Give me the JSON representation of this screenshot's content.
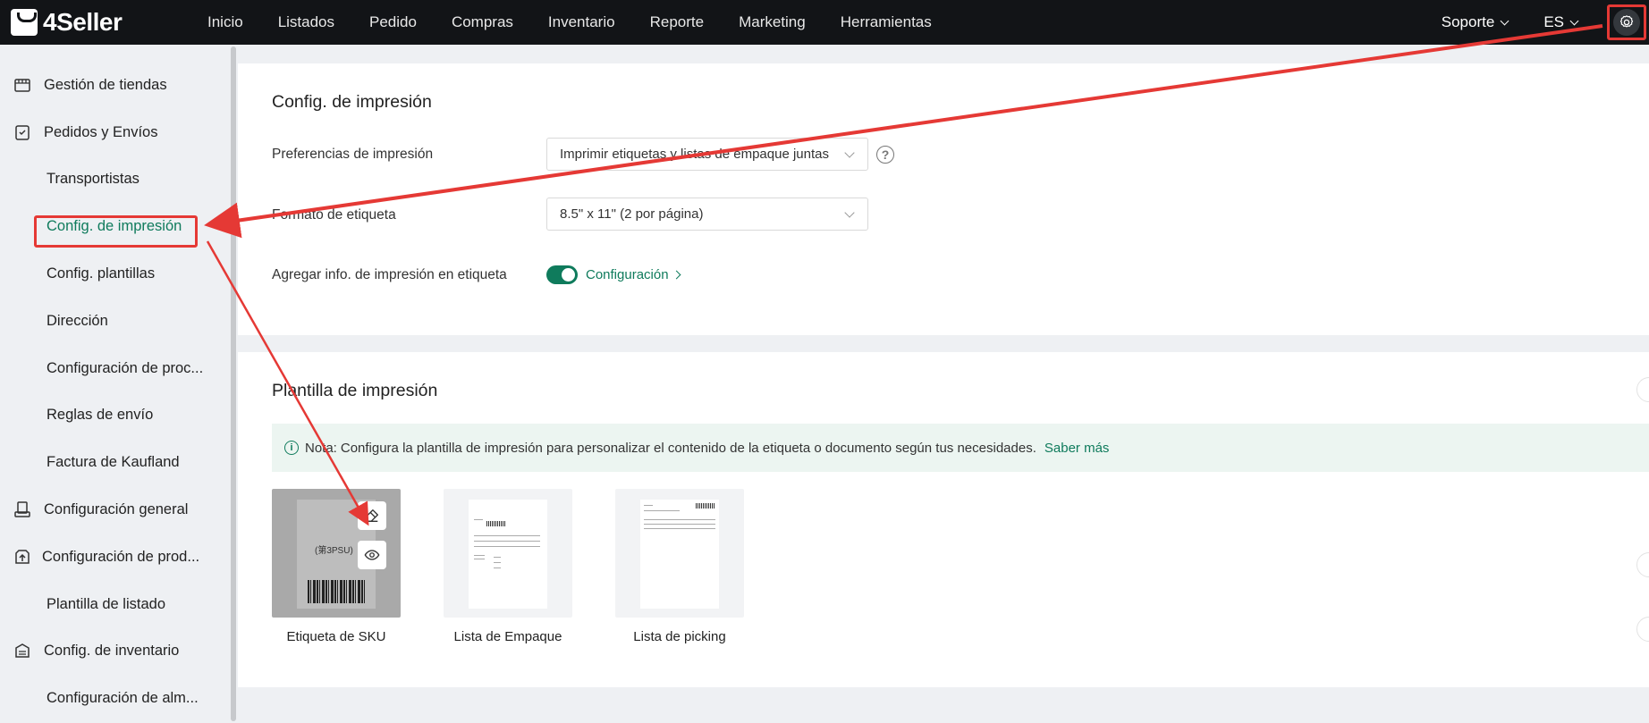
{
  "header": {
    "brand": "4Seller",
    "nav": [
      "Inicio",
      "Listados",
      "Pedido",
      "Compras",
      "Inventario",
      "Reporte",
      "Marketing",
      "Herramientas"
    ],
    "support": "Soporte",
    "language": "ES"
  },
  "sidebar": {
    "items": [
      {
        "label": "Gestión de tiendas",
        "type": "parent",
        "icon": "store-icon"
      },
      {
        "label": "Pedidos y Envíos",
        "type": "parent",
        "icon": "orders-icon"
      },
      {
        "label": "Transportistas",
        "type": "child"
      },
      {
        "label": "Config. de impresión",
        "type": "child",
        "active": true
      },
      {
        "label": "Config. plantillas",
        "type": "child"
      },
      {
        "label": "Dirección",
        "type": "child"
      },
      {
        "label": "Configuración de proc...",
        "type": "child"
      },
      {
        "label": "Reglas de envío",
        "type": "child"
      },
      {
        "label": "Factura de Kaufland",
        "type": "child"
      },
      {
        "label": "Configuración general",
        "type": "parent",
        "icon": "printer-icon"
      },
      {
        "label": "Configuración de prod...",
        "type": "parent",
        "icon": "product-upload-icon"
      },
      {
        "label": "Plantilla de listado",
        "type": "child"
      },
      {
        "label": "Config. de inventario",
        "type": "parent",
        "icon": "inventory-icon"
      },
      {
        "label": "Configuración de alm...",
        "type": "child"
      }
    ]
  },
  "print_settings": {
    "title": "Config. de impresión",
    "preferences_label": "Preferencias de impresión",
    "preferences_value": "Imprimir etiquetas y listas de empaque juntas",
    "label_format_label": "Formato de etiqueta",
    "label_format_value": "8.5\" x 11\" (2 por página)",
    "add_info_label": "Agregar info. de impresión en etiqueta",
    "toggle_on": true,
    "config_link": "Configuración"
  },
  "templates": {
    "title": "Plantilla de impresión",
    "note_prefix": "Nota:",
    "note_text": "Configura la plantilla de impresión para personalizar el contenido de la etiqueta o documento según tus necesidades.",
    "learn_more": "Saber más",
    "sku_preview_text": "(第3PSU)",
    "items": [
      {
        "label": "Etiqueta de SKU"
      },
      {
        "label": "Lista de Empaque"
      },
      {
        "label": "Lista de picking"
      }
    ]
  },
  "colors": {
    "accent": "#0f7b5c",
    "annotation": "#e53935",
    "topbar": "#121417"
  }
}
